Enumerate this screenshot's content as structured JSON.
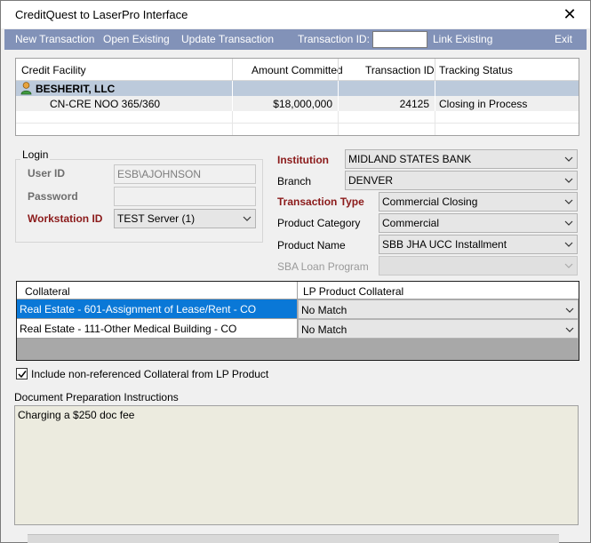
{
  "window": {
    "title": "CreditQuest to LaserPro Interface",
    "close_glyph": "✕"
  },
  "menu": {
    "new_transaction": "New Transaction",
    "open_existing": "Open Existing",
    "update_transaction": "Update Transaction",
    "transaction_id_label": "Transaction ID:",
    "transaction_id_value": "",
    "link_existing": "Link Existing",
    "exit": "Exit"
  },
  "credit_facility_table": {
    "columns": [
      "Credit Facility",
      "Amount Committed",
      "Transaction ID",
      "Tracking Status"
    ],
    "group": {
      "icon": "person-icon",
      "name": "BESHERIT, LLC"
    },
    "rows": [
      {
        "facility": "CN-CRE NOO 365/360",
        "amount": "$18,000,000",
        "transaction_id": "24125",
        "status": "Closing in Process"
      }
    ]
  },
  "login": {
    "legend": "Login",
    "user_id_label": "User ID",
    "user_id_value": "ESB\\AJOHNSON",
    "password_label": "Password",
    "password_value": "",
    "workstation_label": "Workstation ID",
    "workstation_value": "TEST Server (1)"
  },
  "transaction": {
    "institution_label": "Institution",
    "institution_value": "MIDLAND STATES BANK",
    "branch_label": "Branch",
    "branch_value": "DENVER",
    "type_label": "Transaction Type",
    "type_value": "Commercial Closing",
    "category_label": "Product Category",
    "category_value": "Commercial",
    "product_label": "Product Name",
    "product_value": "SBB JHA UCC Installment",
    "sba_label": "SBA Loan Program",
    "sba_value": ""
  },
  "collateral_table": {
    "columns": [
      "Collateral",
      "LP Product Collateral"
    ],
    "rows": [
      {
        "name": "Real Estate - 601-Assignment of Lease/Rent - CO",
        "match": "No Match",
        "selected": true
      },
      {
        "name": "Real Estate - 111-Other Medical Building - CO",
        "match": "No Match",
        "selected": false
      }
    ]
  },
  "include_checkbox": {
    "label": "Include non-referenced Collateral from LP Product",
    "checked": true
  },
  "doc_prep": {
    "label": "Document Preparation Instructions",
    "text": "Charging a $250 doc fee"
  },
  "colors": {
    "menubar": "#8292b8",
    "selection": "#0a78d7",
    "group_row": "#bccadb",
    "required_label": "#8b1a1a",
    "notes_bg": "#ecebdf"
  }
}
